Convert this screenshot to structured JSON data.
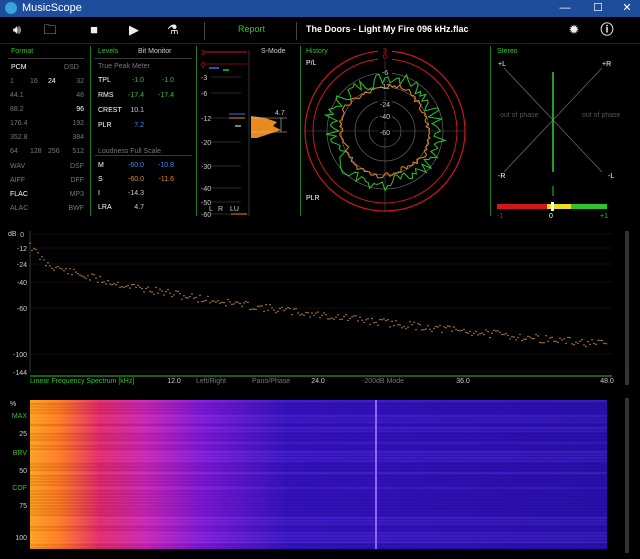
{
  "window": {
    "title": "MusicScope",
    "minimize": "—",
    "maximize": "☐",
    "close": "✕"
  },
  "toolbar": {
    "icons": [
      "speaker-icon",
      "folder-icon",
      "stop-icon",
      "play-icon",
      "microscope-icon"
    ],
    "report_label": "Report",
    "file_title": "The Doors - Light My Fire 096 kHz.flac"
  },
  "format": {
    "title": "Format",
    "pcm": "PCM",
    "dsd": "DSD",
    "rows": [
      [
        "1",
        "16",
        "24",
        "32"
      ],
      [
        "44.1",
        "",
        "",
        "48"
      ],
      [
        "88.2",
        "",
        "",
        "96"
      ],
      [
        "176.4",
        "",
        "",
        "192"
      ],
      [
        "352.8",
        "",
        "",
        "384"
      ],
      [
        "64",
        "128",
        "256",
        "512"
      ]
    ],
    "codecs": [
      [
        "WAV",
        "DSF"
      ],
      [
        "AIFF",
        "DFF"
      ],
      [
        "FLAC",
        "MP3"
      ],
      [
        "ALAC",
        "BWF"
      ]
    ]
  },
  "levels": {
    "title": "Levels",
    "bit_monitor": "Bit Monitor",
    "tpm_title": "True Peak Meter",
    "rows": [
      {
        "name": "TPL",
        "l": "-1.0",
        "r": "-1.0"
      },
      {
        "name": "RMS",
        "l": "-17.4",
        "r": "-17.4"
      },
      {
        "name": "CREST",
        "l": "10.1",
        "r": ""
      },
      {
        "name": "PLR",
        "l": "7.2",
        "r": ""
      }
    ],
    "lufs_title": "Loudness Full Scale",
    "lufs": [
      {
        "name": "M",
        "a": "-60.0",
        "b": "-10.8"
      },
      {
        "name": "S",
        "a": "-60.0",
        "b": "-11.6"
      },
      {
        "name": "I",
        "a": "-14.3",
        "b": ""
      },
      {
        "name": "LRA",
        "a": "4.7",
        "b": ""
      }
    ]
  },
  "meter": {
    "smode": "S-Mode",
    "scale": [
      "3",
      "0",
      "-3",
      "-6",
      "-12",
      "-20",
      "-30",
      "-40",
      "-50",
      "-60"
    ],
    "value": "4.7",
    "foot": [
      "L",
      "R",
      "LU"
    ]
  },
  "history": {
    "title": "History",
    "pl": "P/L",
    "plr": "PLR",
    "rings": [
      "3",
      "0",
      "-6",
      "-12",
      "-24",
      "-40",
      "-60"
    ]
  },
  "stereo": {
    "title": "Stereo",
    "corners": [
      "+L",
      "+R",
      "-R",
      "-L"
    ],
    "oop_left": "out of phase",
    "oop_right": "out of phase",
    "corr_scale": [
      "-1",
      "0",
      "+1"
    ]
  },
  "spectrum": {
    "db_label": "dB",
    "y_ticks": [
      "0",
      "-12",
      "-24",
      "-40",
      "-60",
      "-100",
      "-144"
    ],
    "bottom": [
      "Linear Frequency Spectrum [kHz]",
      "12.0",
      "Left/Right",
      "Pano/Phase",
      "24.0",
      "-200dB Mode",
      "36.0",
      "48.0"
    ]
  },
  "spectrogram": {
    "y_ticks": [
      "%",
      "MAX",
      "25",
      "BRV",
      "50",
      "COF",
      "75",
      "100"
    ]
  },
  "colors": {
    "accent": "#2ec52e",
    "title_bar": "#1e4d9b",
    "red": "#d01818",
    "orange": "#e88a20"
  }
}
